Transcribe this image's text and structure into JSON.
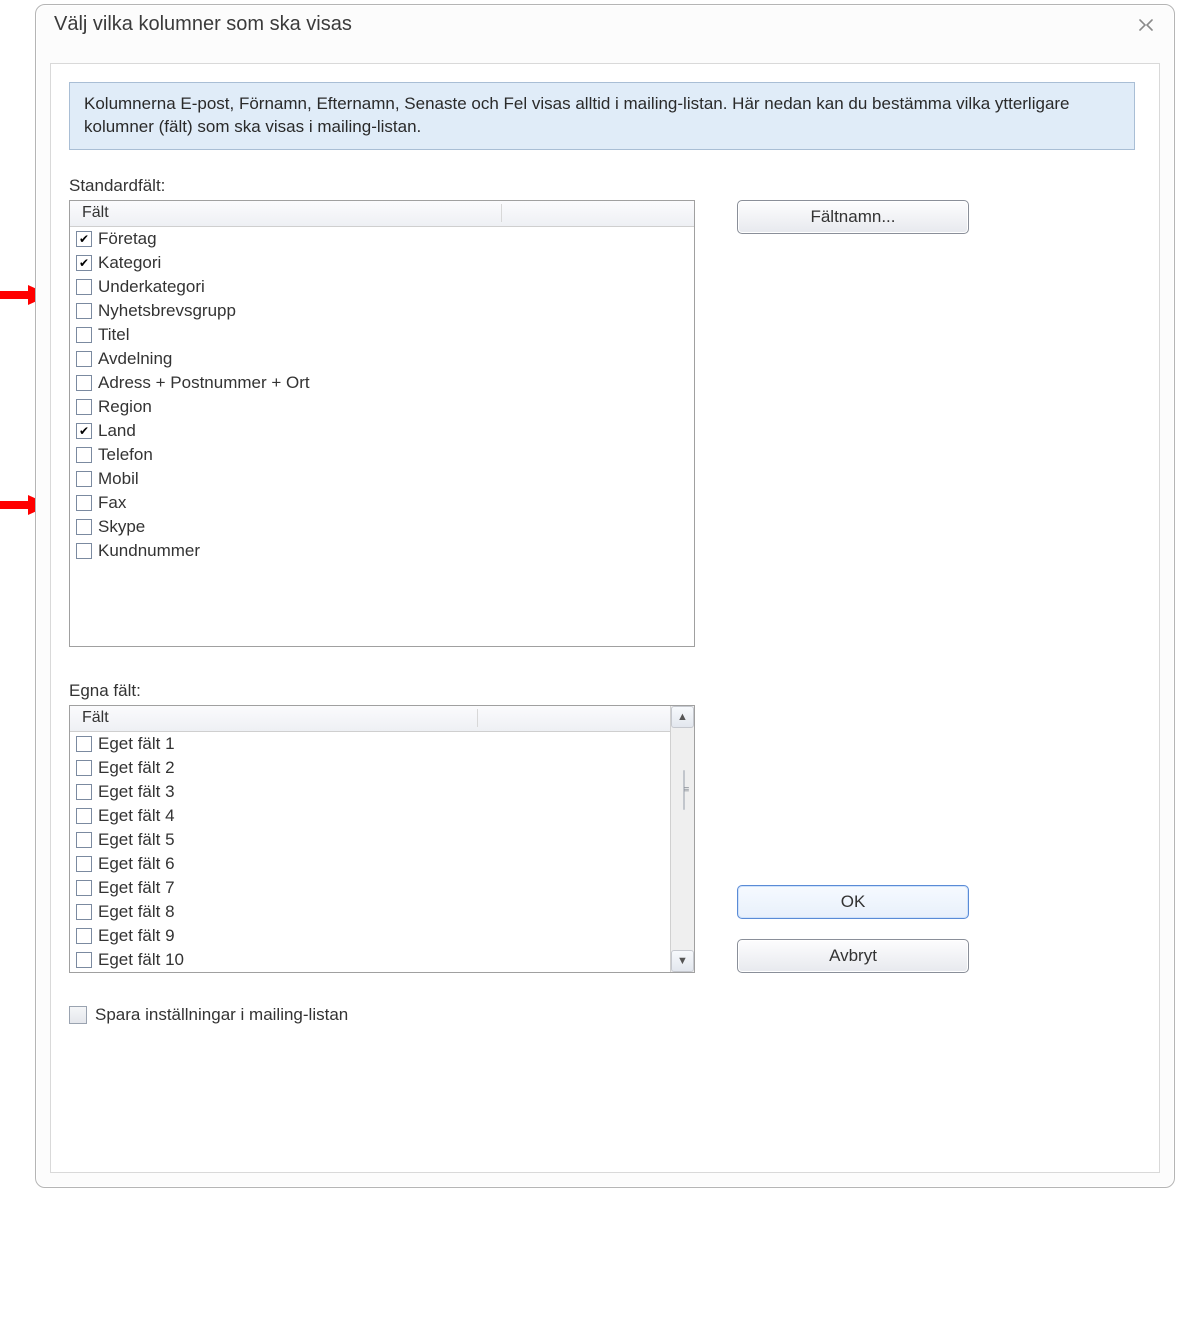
{
  "dialog": {
    "title": "Välj vilka kolumner som ska visas",
    "info": "Kolumnerna E-post, Förnamn, Efternamn, Senaste och Fel visas alltid i mailing-listan. Här nedan kan du bestämma vilka ytterligare kolumner (fält) som ska visas i mailing-listan."
  },
  "labels": {
    "standard_fields": "Standardfält:",
    "own_fields": "Egna fält:",
    "field_column": "Fält",
    "save_in_mailinglist": "Spara inställningar i mailing-listan"
  },
  "buttons": {
    "fieldnames": "Fältnamn...",
    "ok": "OK",
    "cancel": "Avbryt"
  },
  "standard_fields": [
    {
      "label": "Företag",
      "checked": true
    },
    {
      "label": "Kategori",
      "checked": true
    },
    {
      "label": "Underkategori",
      "checked": false
    },
    {
      "label": "Nyhetsbrevsgrupp",
      "checked": false
    },
    {
      "label": "Titel",
      "checked": false
    },
    {
      "label": "Avdelning",
      "checked": false
    },
    {
      "label": "Adress + Postnummer + Ort",
      "checked": false
    },
    {
      "label": "Region",
      "checked": false
    },
    {
      "label": "Land",
      "checked": true
    },
    {
      "label": "Telefon",
      "checked": false
    },
    {
      "label": "Mobil",
      "checked": false
    },
    {
      "label": "Fax",
      "checked": false
    },
    {
      "label": "Skype",
      "checked": false
    },
    {
      "label": "Kundnummer",
      "checked": false
    }
  ],
  "own_fields": [
    {
      "label": "Eget fält 1",
      "checked": false
    },
    {
      "label": "Eget fält 2",
      "checked": false
    },
    {
      "label": "Eget fält 3",
      "checked": false
    },
    {
      "label": "Eget fält 4",
      "checked": false
    },
    {
      "label": "Eget fält 5",
      "checked": false
    },
    {
      "label": "Eget fält 6",
      "checked": false
    },
    {
      "label": "Eget fält 7",
      "checked": false
    },
    {
      "label": "Eget fält 8",
      "checked": false
    },
    {
      "label": "Eget fält 9",
      "checked": false
    },
    {
      "label": "Eget fält 10",
      "checked": false
    }
  ],
  "annotation_arrows": [
    {
      "target_index": 1
    },
    {
      "target_index": 8
    }
  ]
}
